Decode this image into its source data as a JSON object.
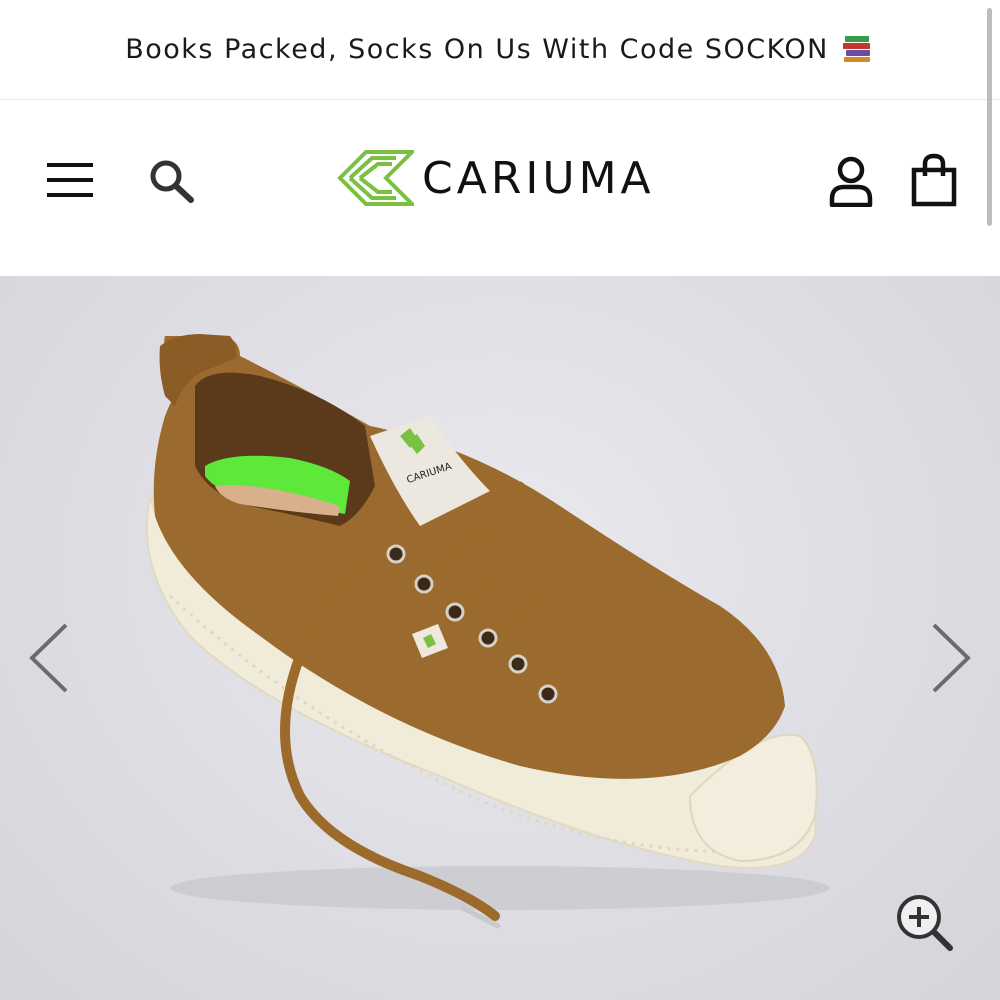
{
  "announcement": {
    "text": "Books Packed, Socks On Us With Code SOCKON",
    "emoji_icon": "books-icon"
  },
  "header": {
    "menu_icon": "hamburger-menu-icon",
    "search_icon": "search-icon",
    "logo_text": "CARIUMA",
    "account_icon": "user-icon",
    "cart_icon": "shopping-bag-icon"
  },
  "product_image": {
    "tag_text": "CARIUMA",
    "prev_icon": "chevron-left-icon",
    "next_icon": "chevron-right-icon",
    "zoom_icon": "zoom-in-icon"
  },
  "colors": {
    "brand_green": "#7ac142",
    "insole_green": "#5ee83a",
    "suede_brown": "#9a6a2e",
    "sole_cream": "#f2ecdc",
    "background": "#dcdce2"
  }
}
